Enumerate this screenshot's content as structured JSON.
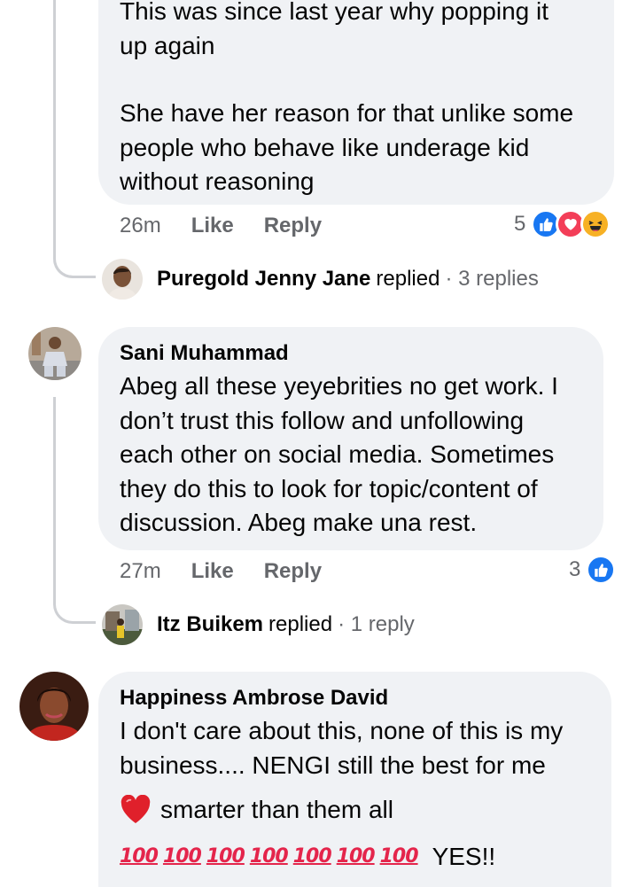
{
  "comments": [
    {
      "id": "first",
      "author": "",
      "paragraphs": [
        [
          "This was since last year why popping it",
          "up again"
        ],
        [
          "She have her reason for that unlike some",
          "people who behave like underage kid",
          "without reasoning"
        ]
      ],
      "time": "26m",
      "like_label": "Like",
      "reply_label": "Reply",
      "reaction_count": "5",
      "reactions": [
        "like-icon",
        "love-icon",
        "haha-icon"
      ],
      "replies": {
        "name": "Puregold Jenny Jane",
        "verb": "replied",
        "count": "· 3 replies"
      }
    },
    {
      "id": "second",
      "author": "Sani Muhammad",
      "paragraphs": [
        [
          "Abeg all these yeyebrities no get work. I",
          "don’t trust this follow and unfollowing",
          "each other on social media. Sometimes",
          "they do this to look for topic/content of",
          "discussion. Abeg make una rest."
        ]
      ],
      "time": "27m",
      "like_label": "Like",
      "reply_label": "Reply",
      "reaction_count": "3",
      "reactions": [
        "like-icon"
      ],
      "replies": {
        "name": "Itz Buikem",
        "verb": "replied",
        "count": "· 1 reply"
      }
    },
    {
      "id": "third",
      "author": "Happiness Ambrose David",
      "paragraphs": [
        [
          "I don't care about this, none of this is my",
          "business.... NENGI still the best for me"
        ]
      ],
      "heart_line": "smarter than them all",
      "hundred_glyph": "100",
      "hundred_count": 7,
      "yes_text": "YES!!"
    }
  ]
}
